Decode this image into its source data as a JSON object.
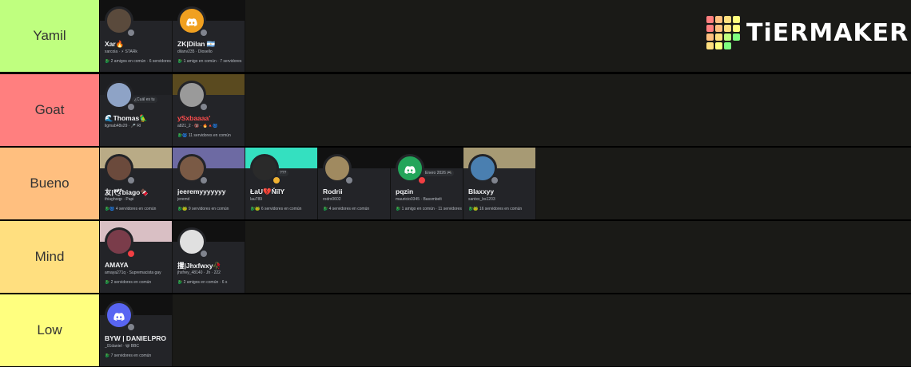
{
  "brand": {
    "name": "TiERMAKER",
    "grid_colors": [
      "#ff7f7f",
      "#ffbf7f",
      "#ffdf7f",
      "#ffff7f",
      "#ff7f7f",
      "#ffbf7f",
      "#ffdf7f",
      "#ffff7f",
      "#ffbf7f",
      "#ffdf7f",
      "#bfff7f",
      "#7fff7f",
      "#ffdf7f",
      "#ffff7f",
      "#7fff7f",
      "#1a1a17"
    ]
  },
  "tiers": [
    {
      "label": "Goat",
      "color": "#ff7f7f",
      "cards": [
        {
          "display": "🌊Thomas🦜",
          "user": "ligmab48s29 · 🎤 RI",
          "mutual": "",
          "bubble": "¿Cuál es tu",
          "banner": "#1e1f22",
          "avatar": "#8ea3c6",
          "status": "#80848e"
        },
        {
          "display": "ySxbaaaa'",
          "user": "a821_2 · 🔞 · 🔥🔺🌀",
          "mutual": "🐉🌀 11 servidores en común",
          "bubble": "",
          "banner": "#5a4a1f",
          "avatar": "#9a9a9a",
          "status": "#80848e",
          "name_color": "#ff4d4d"
        }
      ]
    },
    {
      "label": "Bueno",
      "color": "#ffbf7f",
      "cards": [
        {
          "display": "友|🕊biago🍫",
          "user": "thiaghoqp · Papi",
          "mutual": "🐉🌀 4 servidores en común",
          "bubble": "",
          "banner": "#b9ab86",
          "avatar": "#6b4a3c",
          "status": "#80848e"
        },
        {
          "display": "jeeremyyyyyyy",
          "user": "jeremd",
          "mutual": "🐉🐸 9 servidores en común",
          "bubble": "",
          "banner": "#6d6aa3",
          "avatar": "#7a5a45",
          "status": "#80848e"
        },
        {
          "display": "ŁaU💔ŇïlY",
          "user": "lau789",
          "mutual": "🐉🐸 6 servidores en común",
          "bubble": "???",
          "banner": "#34e0c0",
          "avatar": "#2a2a2a",
          "status": "#f0b232"
        },
        {
          "display": "Rodrii",
          "user": "rodrx0602",
          "mutual": "🐉 4 servidores en común",
          "bubble": "",
          "banner": "#111111",
          "avatar": "#a08a60",
          "status": "#80848e"
        },
        {
          "display": "pqzin",
          "user": "mauricio0345 · Bassmbelt",
          "mutual": "🐉 1 amigo en común · 11 servidores",
          "bubble": "Enero 2026 🎮",
          "banner": "#111111",
          "avatar": "#23a55a",
          "status": "#f23f43",
          "discord": true
        },
        {
          "display": "Blaxxyy",
          "user": "santxx_bs1203",
          "mutual": "🐉🐸 16 servidores en común",
          "bubble": "",
          "banner": "#a79a74",
          "avatar": "#4a7fb0",
          "status": "#80848e"
        }
      ]
    },
    {
      "label": "Mind",
      "color": "#ffdf7f",
      "cards": [
        {
          "display": "AMAYA",
          "user": "amaya271q · Supremacista gay",
          "mutual": "🐉 2 servidores en común",
          "bubble": "",
          "banner": "#d9bfc4",
          "avatar": "#7a3c4a",
          "status": "#f23f43"
        },
        {
          "display": "攫|Jhxfwxy🥀",
          "user": "jhxfrey_48140 · Jh · 222",
          "mutual": "🐉 2 amigos en común · 6 s",
          "bubble": "",
          "banner": "#111111",
          "avatar": "#e0e0e0",
          "status": "#80848e"
        }
      ]
    },
    {
      "label": "Low",
      "color": "#ffff7f",
      "cards": [
        {
          "display": "BYW | DANIELPRO",
          "user": "_01daniel · 😺 BBC",
          "mutual": "🐉 7 servidores en común",
          "bubble": "",
          "banner": "#111111",
          "avatar": "#5865f2",
          "status": "#80848e",
          "discord": true
        }
      ]
    },
    {
      "label": "Yamil",
      "color": "#bfff7f",
      "cards": [
        {
          "display": "Xar🔥",
          "user": "xarcoia · ⚡ STARk",
          "mutual": "🐉 2 amigos en común · 6 servidores",
          "bubble": "",
          "banner": "#111111",
          "avatar": "#5a4a3c",
          "status": "#80848e"
        },
        {
          "display": "ZK|Dilan 🇦🇷",
          "user": "dilanv235 · Diosello",
          "mutual": "🐉 1 amigo en común · 7 servidores",
          "bubble": "",
          "banner": "#111111",
          "avatar": "#f0a020",
          "status": "#80848e",
          "discord": true
        }
      ]
    }
  ]
}
